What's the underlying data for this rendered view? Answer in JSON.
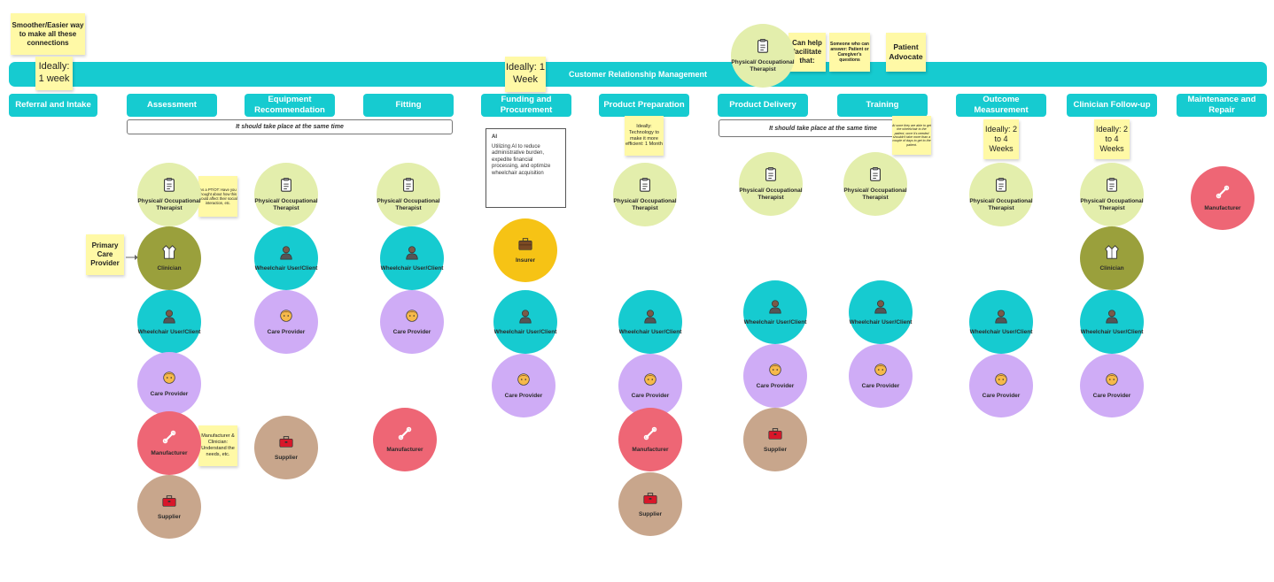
{
  "crm": {
    "label": "Customer Relationship Management"
  },
  "stages": {
    "referral": "Referral and Intake",
    "assessment": "Assessment",
    "equipment": "Equipment Recommendation",
    "fitting": "Fitting",
    "funding": "Funding and Procurement",
    "preparation": "Product Preparation",
    "delivery": "Product Delivery",
    "training": "Training",
    "outcome": "Outcome Measurement",
    "followup": "Clinician Follow-up",
    "maintenance": "Maintenance and Repair"
  },
  "notes": {
    "smoother": "Smoother/Easier way to make all these connections",
    "ideally_1week": "Ideally: 1 week",
    "ideally_1week_b": "Ideally: 1 Week",
    "can_help": "Can help facilitate that:",
    "someone": "Someone who can answer: Patient or Caregiver's questions",
    "patient_advocate": "Patient Advocate",
    "technology": "Ideally: Technology to make it more efficient: 1 Month",
    "training_note": "At sone they are able to get the wheelchair to the patient, once it's needed shouldn't take more than a couple of days to get to the patient.",
    "outcome_weeks": "Ideally: 2 to 4 Weeks",
    "followup_weeks": "Ideally: 2 to 4 Weeks",
    "primary_care": "Primary Care Provider",
    "pt_ot_note": "As a PT/OT: Have you thought about how this would affect their social interaction, etc.",
    "mfr_clinician": "Manufacturer & Clinician: Understand the needs, etc."
  },
  "bars": {
    "same_time_1": "It should take place at the same time",
    "same_time_2": "It should take place at the same time"
  },
  "ai_box": {
    "title": "AI",
    "text": "Utilizing AI to reduce administrative burden, expedite financial processing, and optimize wheelchair acquisition"
  },
  "roles": {
    "pt": "Physical/ Occupational Therapist",
    "wheelchair": "Wheelchair User/Client",
    "care": "Care Provider",
    "manufacturer": "Manufacturer",
    "supplier": "Supplier",
    "clinician": "Clinician",
    "insurer": "Insurer"
  },
  "icons": {
    "pt": "clipboard-icon",
    "wheelchair": "person-icon",
    "care": "face-icon",
    "manufacturer": "wrench-icon",
    "supplier": "toolbox-icon",
    "clinician": "lab-coat-icon",
    "insurer": "briefcase-icon"
  },
  "colors": {
    "teal": "#16cbd0",
    "sticky": "#fff9a6",
    "pt": "#e3eeac",
    "care": "#cfacf6",
    "manufacturer": "#ee6675",
    "supplier": "#c8a68c",
    "clinician": "#9aa03c",
    "insurer": "#f6c315"
  }
}
